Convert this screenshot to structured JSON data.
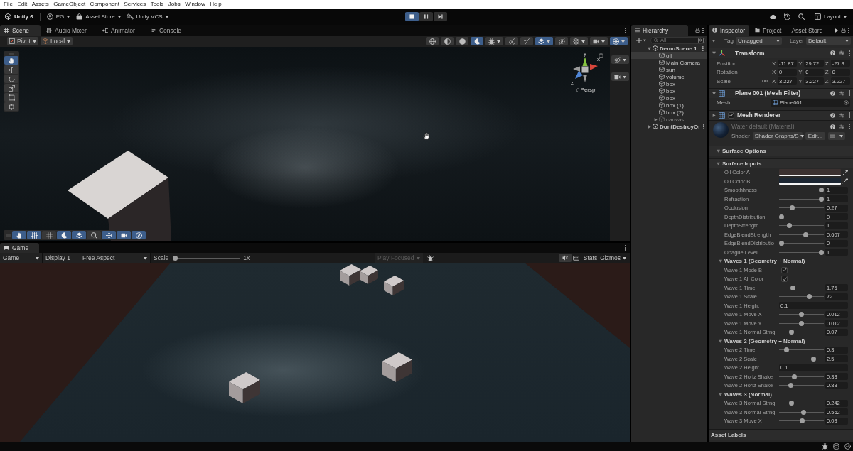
{
  "menu_bar": {
    "items": [
      "File",
      "Edit",
      "Assets",
      "GameObject",
      "Component",
      "Services",
      "Tools",
      "Jobs",
      "Window",
      "Help"
    ]
  },
  "main_toolbar": {
    "product": "Unity 6",
    "account": "EG",
    "store": "Asset Store",
    "vcs": "Unity VCS",
    "play_controls": [
      {
        "kind": "stop",
        "on": true
      },
      {
        "kind": "pause",
        "on": false
      },
      {
        "kind": "step",
        "on": false
      }
    ],
    "layout": "Layout"
  },
  "scene_panel": {
    "tabs": [
      {
        "label": "Scene",
        "kind": "grid",
        "selected": true
      },
      {
        "label": "Audio Mixer",
        "kind": "sliders",
        "selected": false
      },
      {
        "label": "Animator",
        "kind": "nodes",
        "selected": false
      },
      {
        "label": "Console",
        "kind": "console",
        "selected": false
      }
    ],
    "pivot": "Pivot",
    "space": "Local",
    "view_options": [
      {
        "kind": "globe",
        "selected": false,
        "dropdown": false
      },
      {
        "kind": "half",
        "selected": false,
        "dropdown": false
      },
      {
        "kind": "sphere",
        "selected": false,
        "dropdown": false
      },
      {
        "kind": "moon",
        "selected": true,
        "dropdown": false
      },
      {
        "kind": "bug",
        "selected": false,
        "dropdown": true
      },
      {
        "kind": "audio",
        "selected": false,
        "dropdown": false
      },
      {
        "kind": "fx",
        "selected": false,
        "dropdown": false
      },
      {
        "kind": "layers",
        "selected": true,
        "dropdown": true
      },
      {
        "kind": "eyeoff",
        "selected": false,
        "dropdown": false
      },
      {
        "kind": "stack",
        "selected": false,
        "dropdown": true
      },
      {
        "kind": "camera",
        "selected": false,
        "dropdown": true
      },
      {
        "kind": "gizmo",
        "selected": true,
        "dropdown": true
      }
    ],
    "tools": [
      {
        "kind": "hand",
        "selected": true
      },
      {
        "kind": "move",
        "selected": false
      },
      {
        "kind": "rotate",
        "selected": false
      },
      {
        "kind": "scale",
        "selected": false
      },
      {
        "kind": "rect",
        "selected": false
      },
      {
        "kind": "transform",
        "selected": false
      }
    ],
    "overlay_tools": [
      {
        "kind": "hand",
        "selected": true
      },
      {
        "kind": "sliders",
        "selected": true
      },
      {
        "kind": "grid",
        "selected": false
      },
      {
        "kind": "moon",
        "selected": true
      },
      {
        "kind": "layers",
        "selected": true
      },
      {
        "kind": "search",
        "selected": false
      },
      {
        "kind": "move",
        "selected": true
      },
      {
        "kind": "camera",
        "selected": true
      },
      {
        "kind": "compass",
        "selected": true
      }
    ],
    "side_tools": [
      {
        "kind": "eyeoff",
        "dropdown": true
      },
      {
        "kind": "camera",
        "dropdown": true
      }
    ],
    "gizmo": {
      "axes": [
        "y",
        "x",
        "z"
      ],
      "projection": "Persp"
    }
  },
  "game_panel": {
    "tabs": [
      {
        "label": "Game",
        "kind": "gamepad",
        "selected": true
      }
    ],
    "mode": "Game",
    "display": "Display 1",
    "aspect": "Free Aspect",
    "scale_label": "Scale",
    "scale": {
      "level": 0
    },
    "scale_value": "1x",
    "play_mode": {
      "label": "Play Focused",
      "disabled": true
    },
    "stats": "Stats",
    "gizmos": "Gizmos"
  },
  "hierarchy": {
    "tabs": [
      {
        "label": "Hierarchy",
        "kind": "list",
        "selected": true
      }
    ],
    "search": {
      "placeholder": "All"
    },
    "scenes": [
      {
        "name": "DemoScene 1",
        "expanded": true,
        "children": [
          {
            "name": "oil",
            "selected": true,
            "active": true
          },
          {
            "name": "Main Camera",
            "selected": false,
            "active": true
          },
          {
            "name": "sun",
            "selected": false,
            "active": true
          },
          {
            "name": "volume",
            "selected": false,
            "active": true
          },
          {
            "name": "box",
            "selected": false,
            "active": true
          },
          {
            "name": "box",
            "selected": false,
            "active": true
          },
          {
            "name": "box",
            "selected": false,
            "active": true
          },
          {
            "name": "box (1)",
            "selected": false,
            "active": true
          },
          {
            "name": "box (2)",
            "selected": false,
            "active": true
          },
          {
            "name": "canvas",
            "selected": false,
            "active": false,
            "expanded": false
          }
        ]
      },
      {
        "name": "DontDestroyOr",
        "expanded": false
      }
    ]
  },
  "inspector": {
    "tabs": [
      {
        "label": "Inspector",
        "kind": "info",
        "selected": true
      },
      {
        "label": "Project",
        "kind": "folder",
        "selected": false
      },
      {
        "label": "Asset Store",
        "kind": "none",
        "selected": false
      }
    ],
    "tag_label": "Tag",
    "tag": "Untagged",
    "layer_label": "Layer",
    "layer": "Default",
    "transform": {
      "title": "Transform",
      "expanded": true,
      "rows": [
        {
          "label": "Position",
          "linked": false,
          "values": [
            {
              "axis": "X",
              "value": "-11.87"
            },
            {
              "axis": "Y",
              "value": "29.72"
            },
            {
              "axis": "Z",
              "value": "-27.3"
            }
          ]
        },
        {
          "label": "Rotation",
          "linked": false,
          "values": [
            {
              "axis": "X",
              "value": "0"
            },
            {
              "axis": "Y",
              "value": "0"
            },
            {
              "axis": "Z",
              "value": "0"
            }
          ]
        },
        {
          "label": "Scale",
          "linked": true,
          "values": [
            {
              "axis": "X",
              "value": "3.227"
            },
            {
              "axis": "Y",
              "value": "3.227"
            },
            {
              "axis": "Z",
              "value": "3.227"
            }
          ]
        }
      ]
    },
    "mesh_filter": {
      "title": "Plane 001 (Mesh Filter)",
      "expanded": true,
      "field_label": "Mesh",
      "mesh": "Plane001"
    },
    "mesh_renderer": {
      "title": "Mesh Renderer",
      "expanded": false,
      "enabled": true
    },
    "material": {
      "name": "Water default (Material)",
      "shader_label": "Shader",
      "shader": "Shader Graphs/S",
      "edit": "Edit..."
    },
    "sections": [
      {
        "title": "Surface Options",
        "expanded": true
      },
      {
        "title": "Surface Inputs",
        "expanded": true,
        "rows": [
          {
            "kind": "color",
            "label": "Oil Color A",
            "color": "#3b3130"
          },
          {
            "kind": "color",
            "label": "Oil Color B",
            "color": "#1c2632"
          },
          {
            "kind": "slider",
            "label": "Smoothhness",
            "level": 1,
            "value": "1"
          },
          {
            "kind": "slider",
            "label": "Refraction",
            "level": 1,
            "value": "1"
          },
          {
            "kind": "slider",
            "label": "Occlusion",
            "level": 0.27,
            "value": "0.27"
          },
          {
            "kind": "slider",
            "label": "DepthDistribution",
            "level": 0,
            "value": "0"
          },
          {
            "kind": "slider",
            "label": "DepthStrength",
            "level": 0.2,
            "value": "1"
          },
          {
            "kind": "slider",
            "label": "EdgeBlendStrength",
            "level": 0.6,
            "value": "0.607"
          },
          {
            "kind": "slider",
            "label": "EdgeBlendDistributio",
            "level": 0,
            "value": "0"
          },
          {
            "kind": "slider",
            "label": "Opague Level",
            "level": 1,
            "value": "1"
          }
        ]
      },
      {
        "title": "Waves 1 (Geometry + Normal)",
        "expanded": true,
        "rows": [
          {
            "kind": "checkbox",
            "label": "Wave 1 Mode B",
            "checked": true
          },
          {
            "kind": "checkbox",
            "label": "Wave 1 All Color",
            "checked": true
          },
          {
            "kind": "slider",
            "label": "Wave 1 Time",
            "level": 0.28,
            "value": "1.75"
          },
          {
            "kind": "slider",
            "label": "Wave 1 Scale",
            "level": 0.7,
            "value": "72"
          },
          {
            "kind": "field",
            "label": "Wave 1 Height",
            "value": "0.1"
          },
          {
            "kind": "slider",
            "label": "Wave 1 Move X",
            "level": 0.5,
            "value": "0.012"
          },
          {
            "kind": "slider",
            "label": "Wave 1 Move Y",
            "level": 0.5,
            "value": "0.012"
          },
          {
            "kind": "slider",
            "label": "Wave 1 Normal Strng",
            "level": 0.25,
            "value": "0.07"
          }
        ]
      },
      {
        "title": "Waves 2 (Geometry + Normal)",
        "expanded": true,
        "rows": [
          {
            "kind": "slider",
            "label": "Wave 2 Time",
            "level": 0.13,
            "value": "0.3"
          },
          {
            "kind": "slider",
            "label": "Wave 2 Scale",
            "level": 0.8,
            "value": "2.5"
          },
          {
            "kind": "field",
            "label": "Wave 2 Height",
            "value": "0.1"
          },
          {
            "kind": "slider",
            "label": "Wave 2 Horiz Shake",
            "level": 0.33,
            "value": "0.33"
          },
          {
            "kind": "slider",
            "label": "Wave 2 Horiz Shake",
            "level": 0.23,
            "value": "0.88"
          }
        ]
      },
      {
        "title": "Waves 3 (Normal)",
        "expanded": true,
        "rows": [
          {
            "kind": "slider",
            "label": "Wave 3 Normal Strng",
            "level": 0.25,
            "value": "0.242"
          },
          {
            "kind": "slider",
            "label": "Wave 3 Normal Strng",
            "level": 0.55,
            "value": "0.562"
          },
          {
            "kind": "slider",
            "label": "Wave 3 Move X",
            "level": 0.52,
            "value": "0.03"
          }
        ]
      }
    ],
    "asset_labels": "Asset Labels"
  }
}
